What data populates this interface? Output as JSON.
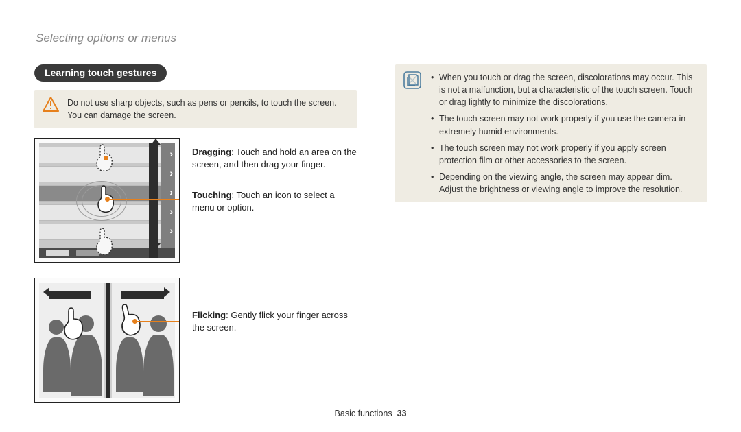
{
  "running_head": "Selecting options or menus",
  "pill": "Learning touch gestures",
  "warning": "Do not use sharp objects, such as pens or pencils, to touch the screen. You can damage the screen.",
  "gestures": {
    "dragging": {
      "title": "Dragging",
      "text": ": Touch and hold an area on the screen, and then drag your finger."
    },
    "touching": {
      "title": "Touching",
      "text": ": Touch an icon to select a menu or option."
    },
    "flicking": {
      "title": "Flicking",
      "text": ": Gently flick your finger across the screen."
    }
  },
  "info_notes": [
    "When you touch or drag the screen, discolorations may occur. This is not a malfunction, but a characteristic of the touch screen. Touch or drag lightly to minimize the discolorations.",
    "The touch screen may not work properly if you use the camera in extremely humid environments.",
    "The touch screen may not work properly if you apply screen protection film or other accessories to the screen.",
    "Depending on the viewing angle, the screen may appear dim. Adjust the brightness or viewing angle to improve the resolution."
  ],
  "footer": {
    "section": "Basic functions",
    "page": "33"
  }
}
